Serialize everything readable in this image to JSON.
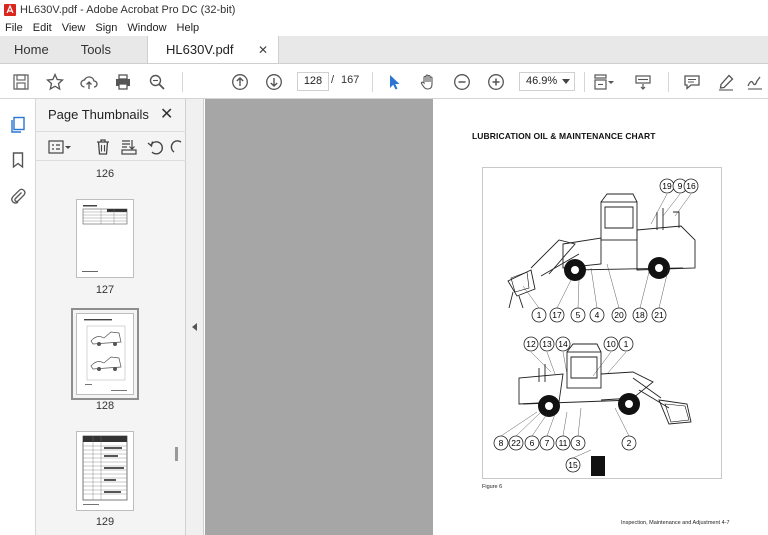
{
  "window": {
    "title": "HL630V.pdf - Adobe Acrobat Pro DC (32-bit)"
  },
  "menu": [
    "File",
    "Edit",
    "View",
    "Sign",
    "Window",
    "Help"
  ],
  "tabs": {
    "home": "Home",
    "tools": "Tools",
    "document": "HL630V.pdf",
    "close_glyph": "✕"
  },
  "toolbar": {
    "current_page": "128",
    "page_separator": "/",
    "total_pages": "167",
    "zoom": "46.9%",
    "icons": [
      "save-icon",
      "bookmark-star-icon",
      "upload-cloud-icon",
      "print-icon",
      "zoom-search-icon",
      "page-up-icon",
      "page-down-icon",
      "select-arrow-icon",
      "hand-icon",
      "zoom-out-icon",
      "zoom-in-icon",
      "page-fit-icon",
      "scroll-mode-icon",
      "comment-icon",
      "highlight-pen-icon",
      "sign-icon"
    ]
  },
  "thumbnails_panel": {
    "title": "Page Thumbnails",
    "close_glyph": "✕",
    "pages": [
      {
        "number": "126"
      },
      {
        "number": "127"
      },
      {
        "number": "128",
        "selected": true
      },
      {
        "number": "129"
      }
    ]
  },
  "document": {
    "heading": "LUBRICATION OIL & MAINTENANCE CHART",
    "figure_caption": "Figure 6",
    "footer": "Inspection, Maintenance and Adjustment 4-7",
    "top_callouts": [
      "19",
      "9",
      "16",
      "1",
      "17",
      "5",
      "4",
      "20",
      "18",
      "21"
    ],
    "bottom_callouts": [
      "12",
      "13",
      "14",
      "10",
      "1",
      "8",
      "22",
      "6",
      "7",
      "11",
      "3",
      "2",
      "15"
    ]
  },
  "colors": {
    "accent": "#2a74d4",
    "canvas_gray": "#a6a6a6",
    "tab_bar": "#e8e8e8"
  }
}
